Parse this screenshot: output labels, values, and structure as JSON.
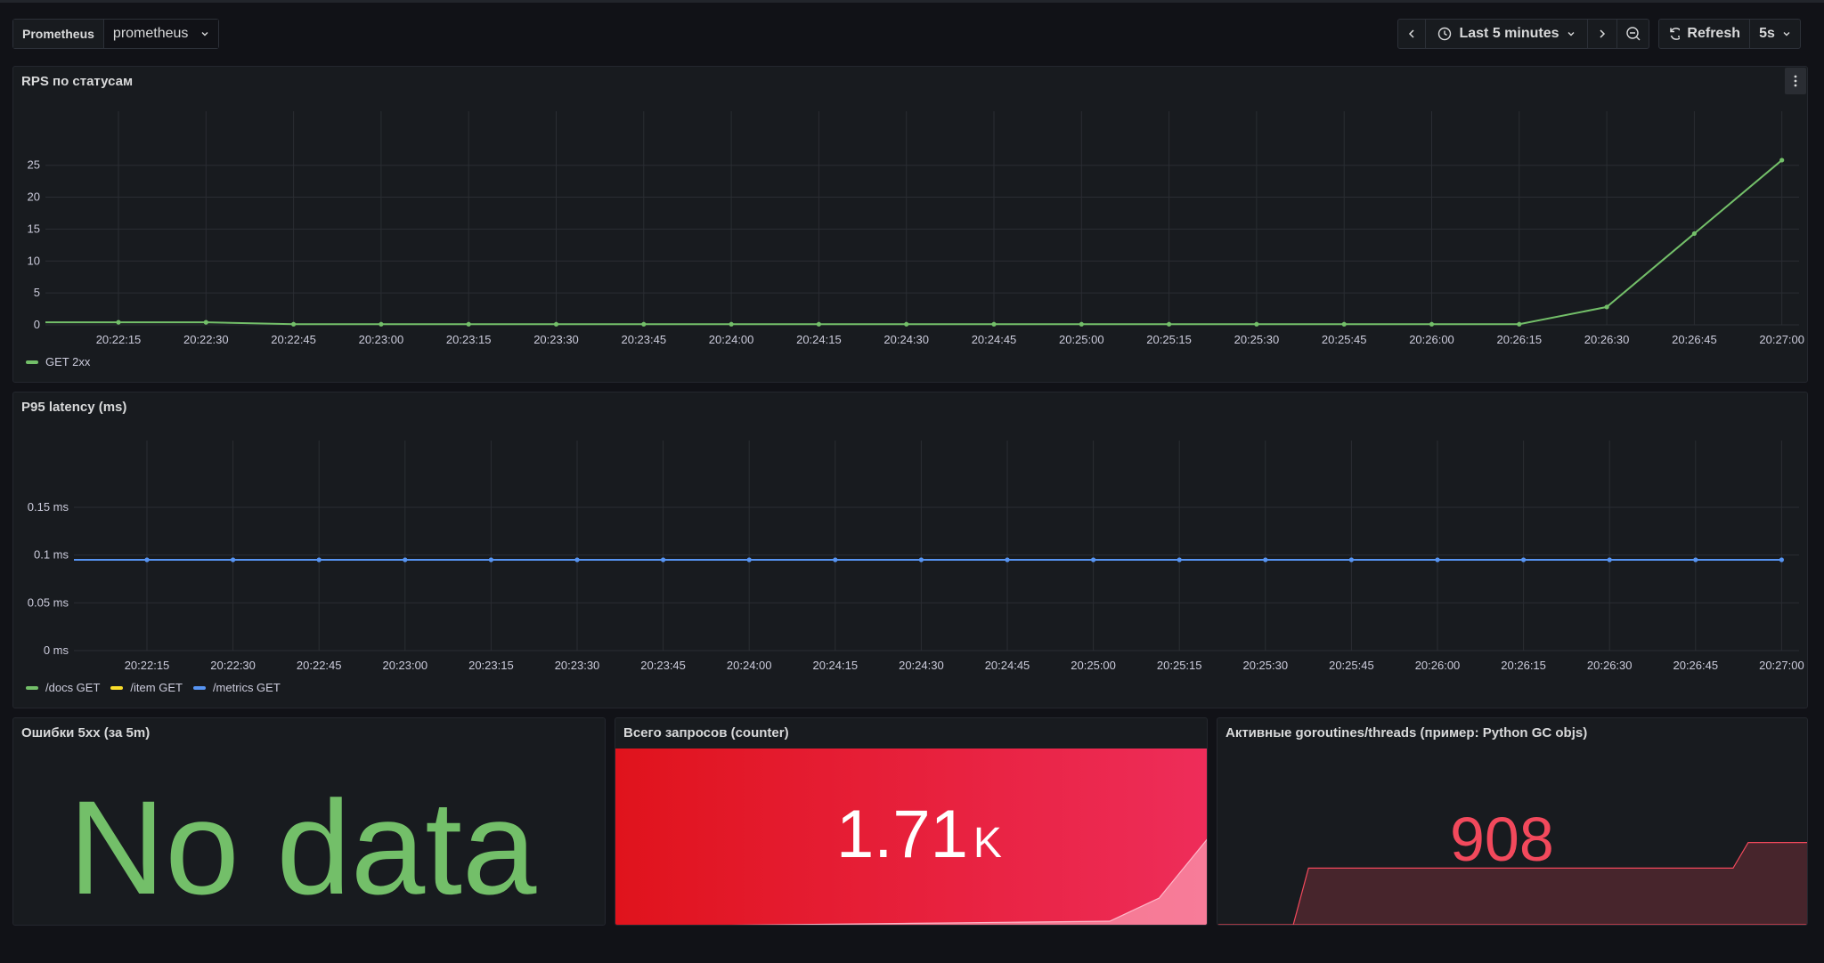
{
  "toolbar": {
    "datasource_label": "Prometheus",
    "datasource_value": "prometheus",
    "time_range": "Last 5 minutes",
    "refresh_label": "Refresh",
    "refresh_interval": "5s"
  },
  "panels": {
    "rps": {
      "title": "RPS по статусам"
    },
    "latency": {
      "title": "P95 latency (ms)"
    },
    "errors": {
      "title": "Ошибки 5xx (за 5m)",
      "value": "No data",
      "color": "#73bf69"
    },
    "total": {
      "title": "Всего запросов (counter)",
      "value": "1.71",
      "unit": "K"
    },
    "threads": {
      "title": "Активные goroutines/threads (пример: Python GC objs)",
      "value": "908",
      "color": "#f2495c"
    }
  },
  "chart_data": [
    {
      "type": "line",
      "title": "RPS по статусам",
      "x": [
        "20:22:05",
        "20:22:15",
        "20:22:30",
        "20:22:45",
        "20:23:00",
        "20:23:15",
        "20:23:30",
        "20:23:45",
        "20:24:00",
        "20:24:15",
        "20:24:30",
        "20:24:45",
        "20:25:00",
        "20:25:15",
        "20:25:30",
        "20:25:45",
        "20:26:00",
        "20:26:15",
        "20:26:30",
        "20:26:45",
        "20:27:00"
      ],
      "x_tick_labels": [
        "20:22:15",
        "20:22:30",
        "20:22:45",
        "20:23:00",
        "20:23:15",
        "20:23:30",
        "20:23:45",
        "20:24:00",
        "20:24:15",
        "20:24:30",
        "20:24:45",
        "20:25:00",
        "20:25:15",
        "20:25:30",
        "20:25:45",
        "20:26:00",
        "20:26:15",
        "20:26:30",
        "20:26:45",
        "20:27:00"
      ],
      "y_ticks": [
        0,
        5,
        10,
        15,
        20,
        25
      ],
      "ylim": [
        0,
        29
      ],
      "series": [
        {
          "name": "GET 2xx",
          "color": "#73bf69",
          "values": [
            0.4,
            0.4,
            0.4,
            0.1,
            0.1,
            0.1,
            0.1,
            0.1,
            0.1,
            0.1,
            0.1,
            0.1,
            0.1,
            0.1,
            0.1,
            0.1,
            0.1,
            0.1,
            2.8,
            14.3,
            25.8
          ]
        }
      ],
      "legend_position": "bottom-left"
    },
    {
      "type": "line",
      "title": "P95 latency (ms)",
      "x": [
        "20:22:05",
        "20:22:15",
        "20:22:30",
        "20:22:45",
        "20:23:00",
        "20:23:15",
        "20:23:30",
        "20:23:45",
        "20:24:00",
        "20:24:15",
        "20:24:30",
        "20:24:45",
        "20:25:00",
        "20:25:15",
        "20:25:30",
        "20:25:45",
        "20:26:00",
        "20:26:15",
        "20:26:30",
        "20:26:45",
        "20:27:00"
      ],
      "x_tick_labels": [
        "20:22:15",
        "20:22:30",
        "20:22:45",
        "20:23:00",
        "20:23:15",
        "20:23:30",
        "20:23:45",
        "20:24:00",
        "20:24:15",
        "20:24:30",
        "20:24:45",
        "20:25:00",
        "20:25:15",
        "20:25:30",
        "20:25:45",
        "20:26:00",
        "20:26:15",
        "20:26:30",
        "20:26:45",
        "20:27:00"
      ],
      "y_ticks": [
        "0 ms",
        "0.05 ms",
        "0.1 ms",
        "0.15 ms"
      ],
      "y_values": [
        0,
        0.05,
        0.1,
        0.15
      ],
      "ylim": [
        0,
        0.19
      ],
      "series": [
        {
          "name": "/docs GET",
          "color": "#73bf69",
          "values": []
        },
        {
          "name": "/item GET",
          "color": "#fade2a",
          "values": []
        },
        {
          "name": "/metrics GET",
          "color": "#5794f2",
          "values": [
            0.095,
            0.095,
            0.095,
            0.095,
            0.095,
            0.095,
            0.095,
            0.095,
            0.095,
            0.095,
            0.095,
            0.095,
            0.095,
            0.095,
            0.095,
            0.095,
            0.095,
            0.095,
            0.095,
            0.095,
            0.095
          ]
        }
      ],
      "legend_position": "bottom-left"
    },
    {
      "type": "area",
      "title": "Всего запросов (counter)",
      "values": [
        0.0,
        0.003,
        0.006,
        0.009,
        0.012,
        0.015,
        0.018,
        0.021,
        0.024,
        0.027,
        0.03,
        0.16,
        0.5
      ]
    },
    {
      "type": "area",
      "title": "Активные goroutines/threads (пример: Python GC objs)",
      "values": [
        0.0,
        0.0,
        0.0,
        0.0,
        0.0,
        0.0,
        0.53,
        0.53,
        0.53,
        0.53,
        0.53,
        0.53,
        0.53,
        0.53,
        0.53,
        0.53,
        0.53,
        0.53,
        0.53,
        0.53,
        0.53,
        0.53,
        0.53,
        0.53,
        0.53,
        0.53,
        0.53,
        0.53,
        0.53,
        0.53,
        0.53,
        0.53,
        0.53,
        0.53,
        0.53,
        0.77,
        0.77,
        0.77,
        0.77,
        0.77
      ]
    }
  ]
}
